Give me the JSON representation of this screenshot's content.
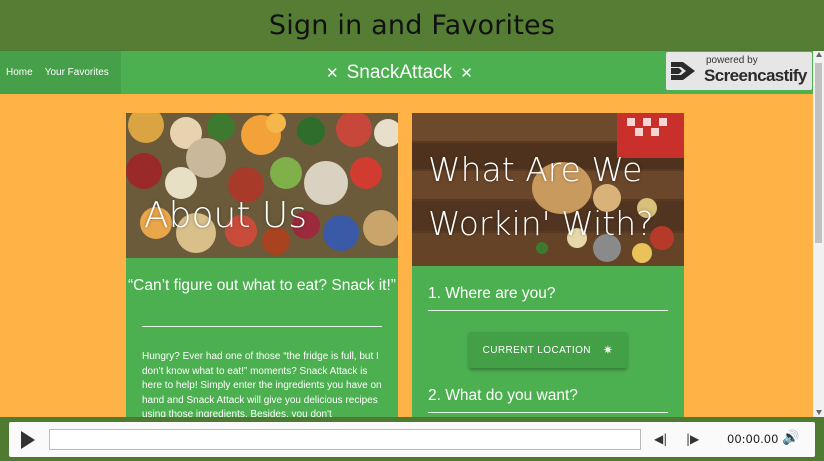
{
  "recording_title": "Sign in and Favorites",
  "nav": {
    "home": "Home",
    "favorites": "Your Favorites",
    "brand": "SnackAttack",
    "brand_icon_left": "utensils-icon",
    "brand_icon_right": "utensils-icon"
  },
  "badge": {
    "powered_by": "powered by",
    "name": "Screencastify",
    "icon": "screencastify-logo-icon"
  },
  "about": {
    "hero_title": "About Us",
    "quote": "“Can’t figure out what to eat? Snack it!”",
    "body": "Hungry? Ever had one of those “the fridge is full, but I don't know what to eat!” moments? Snack Attack is here to help! Simply enter the ingredients you have on hand and Snack Attack will give you delicious recipes using those ingredients. Besides, you don't"
  },
  "working": {
    "hero_title": "What Are We Workin' With?",
    "step1": "1. Where are you?",
    "location_button": "CURRENT LOCATION",
    "location_icon": "crosshair-icon",
    "step2": "2. What do you want?"
  },
  "annotation_tools": [
    {
      "name": "pause-icon",
      "glyph": "❚❚"
    },
    {
      "name": "cursor-icon",
      "glyph": "➤"
    },
    {
      "name": "pen-icon",
      "glyph": "✎"
    },
    {
      "name": "highlighter-icon",
      "glyph": "▰"
    },
    {
      "name": "timer-icon",
      "glyph": "⏱"
    },
    {
      "name": "close-icon",
      "glyph": "✕"
    }
  ],
  "player": {
    "time": "00:00.00",
    "play_icon": "play-icon",
    "rewind_icon": "skip-back-icon",
    "forward_icon": "skip-forward-icon",
    "volume_icon": "volume-icon"
  },
  "colors": {
    "navbar": "#4caf50",
    "page_bg": "#ffb347",
    "frame": "#567d34"
  }
}
